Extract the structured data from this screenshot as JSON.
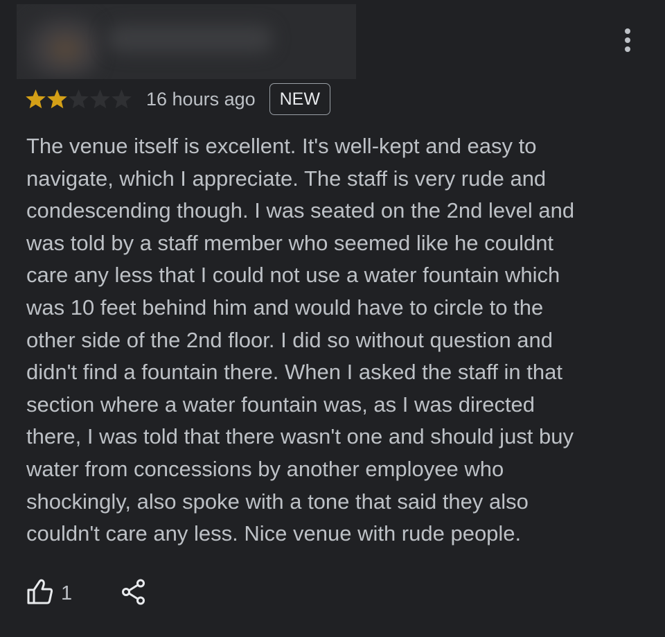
{
  "review": {
    "rating": 2,
    "max_rating": 5,
    "time_ago": "16 hours ago",
    "badge": "NEW",
    "text": "The venue itself is excellent. It's well-kept and easy to\nnavigate, which I appreciate. The staff is very rude and\ncondescending though. I was seated on the 2nd level and\nwas told by a staff member who seemed like he couldnt\ncare any less that I could not use a water fountain which\nwas 10 feet behind him and would have to circle to the\nother side of the 2nd floor. I did so without question and\ndidn't find a fountain there. When I asked the staff in that\nsection where a water fountain was, as I was directed\nthere, I was told that there wasn't one and should just buy\nwater from concessions by another employee who\nshockingly, also spoke with a tone that said they also\ncouldn't care any less. Nice venue with rude people.",
    "like_count": "1"
  },
  "icons": {
    "more": "more-vert-icon",
    "like": "thumb-up-icon",
    "share": "share-icon",
    "star": "star-icon"
  },
  "colors": {
    "background": "#202124",
    "text": "#bdc1c6",
    "star_filled": "#d4a017",
    "star_empty": "#2f3033"
  }
}
